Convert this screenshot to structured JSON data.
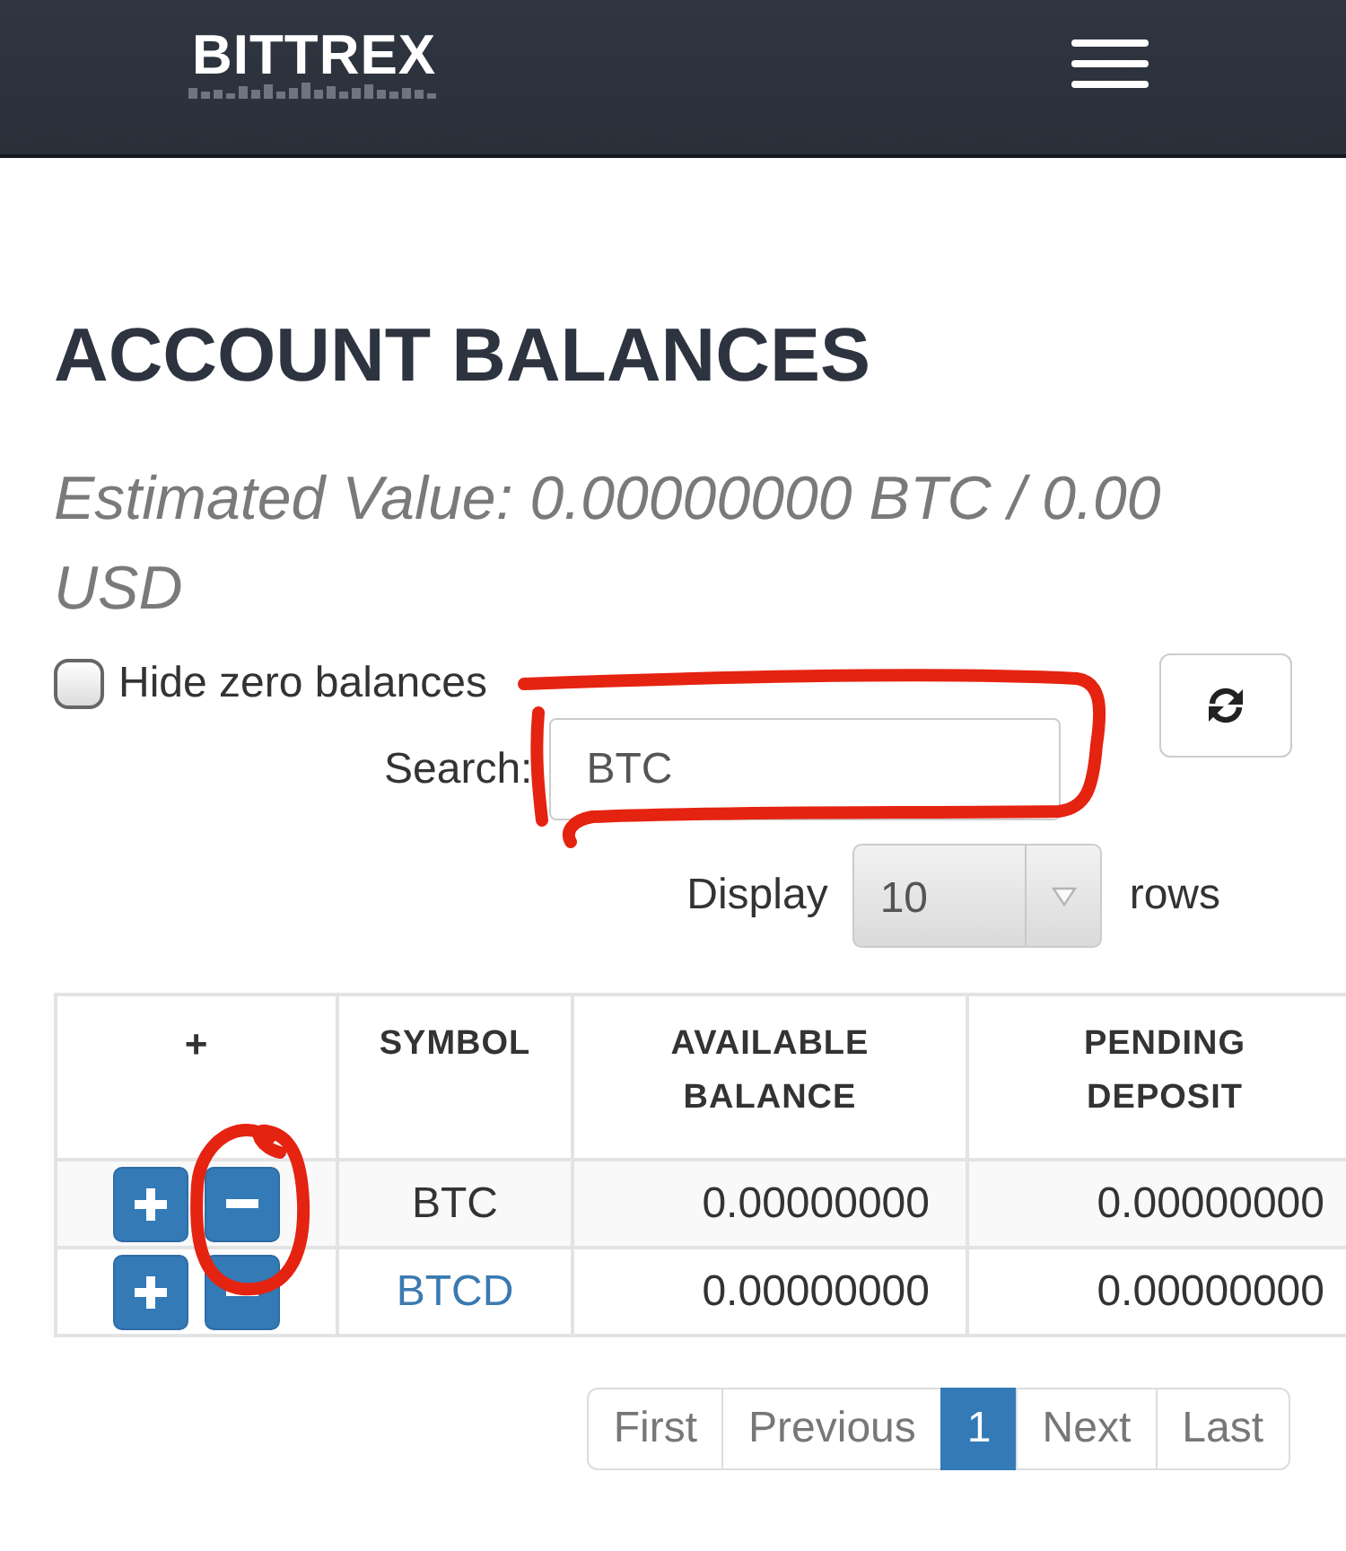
{
  "header": {
    "logo": "BITTREX"
  },
  "page": {
    "title": "ACCOUNT BALANCES",
    "estimated_value": "Estimated Value: 0.00000000 BTC / 0.00 USD"
  },
  "filters": {
    "hide_zero_balances": {
      "label": "Hide zero balances",
      "checked": false
    },
    "search": {
      "label": "Search:",
      "value": "BTC"
    },
    "display": {
      "label": "Display",
      "value": "10",
      "unit": "rows"
    }
  },
  "table": {
    "columns": [
      "+",
      "SYMBOL",
      "AVAILABLE BALANCE",
      "PENDING DEPOSIT"
    ],
    "rows": [
      {
        "symbol": "BTC",
        "link": false,
        "available_balance": "0.00000000",
        "pending_deposit": "0.00000000"
      },
      {
        "symbol": "BTCD",
        "link": true,
        "available_balance": "0.00000000",
        "pending_deposit": "0.00000000"
      }
    ]
  },
  "pagination": [
    {
      "label": "First",
      "selected": false
    },
    {
      "label": "Previous",
      "selected": false
    },
    {
      "label": "1",
      "selected": true
    },
    {
      "label": "Next",
      "selected": false
    },
    {
      "label": "Last",
      "selected": false
    }
  ]
}
